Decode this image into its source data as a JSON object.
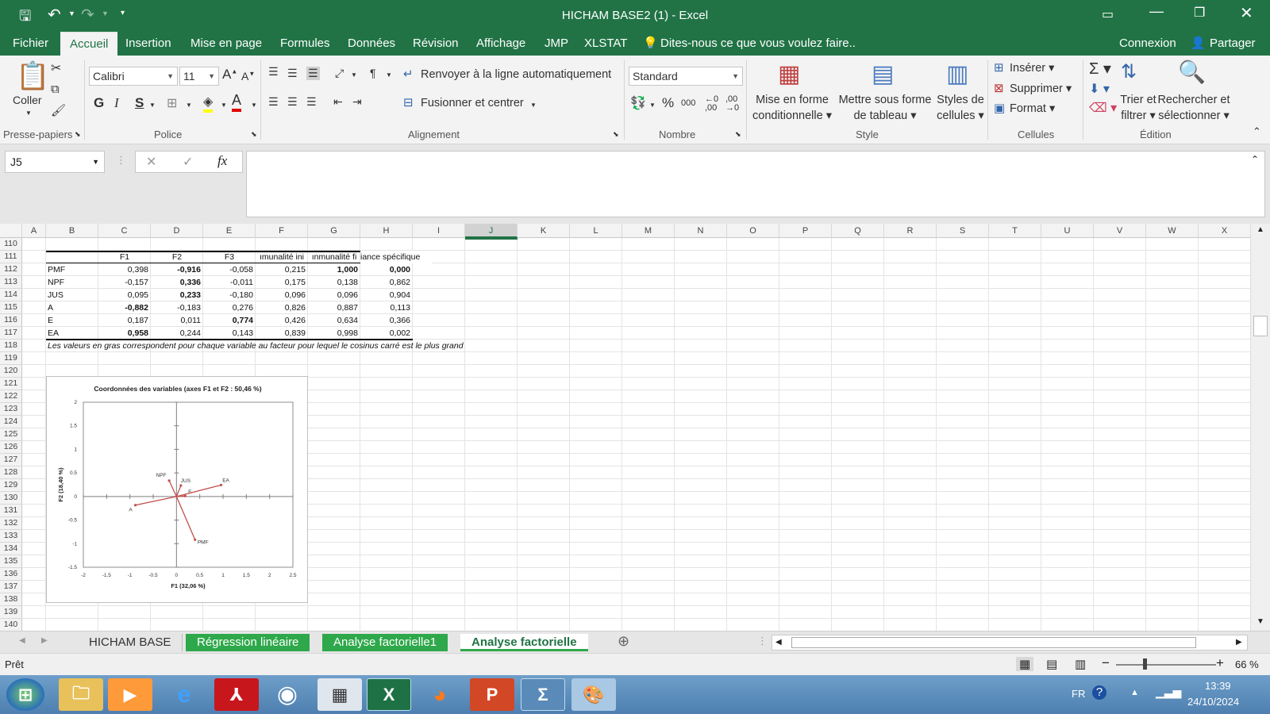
{
  "window": {
    "title": "HICHAM BASE2 (1) - Excel"
  },
  "tabs": [
    "Fichier",
    "Accueil",
    "Insertion",
    "Mise en page",
    "Formules",
    "Données",
    "Révision",
    "Affichage",
    "JMP",
    "XLSTAT"
  ],
  "tellme": "Dites-nous ce que vous voulez faire..",
  "account": {
    "signin": "Connexion",
    "share": "Partager"
  },
  "ribbon": {
    "clipboard": {
      "paste": "Coller",
      "label": "Presse-papiers"
    },
    "font": {
      "name": "Calibri",
      "size": "11",
      "label": "Police",
      "bold": "G",
      "italic": "I",
      "underline": "S"
    },
    "alignment": {
      "wrap": "Renvoyer à la ligne automatiquement",
      "merge": "Fusionner et centrer",
      "label": "Alignement"
    },
    "number": {
      "format": "Standard",
      "label": "Nombre",
      "percent": "%",
      "thousands": "000"
    },
    "style": {
      "cond": "Mise en forme conditionnelle",
      "table": "Mettre sous forme de tableau",
      "cellstyles": "Styles de cellules",
      "label": "Style"
    },
    "cells": {
      "insert": "Insérer",
      "delete": "Supprimer",
      "format": "Format",
      "label": "Cellules"
    },
    "editing": {
      "sort": "Trier et filtrer",
      "find": "Rechercher et sélectionner",
      "label": "Édition"
    }
  },
  "formula": {
    "namebox": "J5",
    "fx": "fx",
    "value": ""
  },
  "columns": [
    "A",
    "B",
    "C",
    "D",
    "E",
    "F",
    "G",
    "H",
    "I",
    "J",
    "K",
    "L",
    "M",
    "N",
    "O",
    "P",
    "Q",
    "R",
    "S",
    "T",
    "U",
    "V",
    "W",
    "X"
  ],
  "rows": [
    "110",
    "111",
    "112",
    "113",
    "114",
    "115",
    "116",
    "117",
    "118",
    "119",
    "120",
    "121",
    "122",
    "123",
    "124",
    "125",
    "126",
    "127",
    "128",
    "129",
    "130",
    "131",
    "132",
    "133",
    "134",
    "135",
    "136",
    "137",
    "138",
    "139",
    "140"
  ],
  "table": {
    "headers": [
      "F1",
      "F2",
      "F3",
      "ımunalité ini",
      "ınmunalité fi",
      "iance spécifique"
    ],
    "rows": [
      {
        "name": "PMF",
        "v": [
          "0,398",
          "-0,916",
          "-0,058",
          "0,215",
          "1,000",
          "0,000"
        ],
        "bold": [
          1,
          4,
          5
        ]
      },
      {
        "name": "NPF",
        "v": [
          "-0,157",
          "0,336",
          "-0,011",
          "0,175",
          "0,138",
          "0,862"
        ],
        "bold": [
          1
        ]
      },
      {
        "name": "JUS",
        "v": [
          "0,095",
          "0,233",
          "-0,180",
          "0,096",
          "0,096",
          "0,904"
        ],
        "bold": [
          1
        ]
      },
      {
        "name": "A",
        "v": [
          "-0,882",
          "-0,183",
          "0,276",
          "0,826",
          "0,887",
          "0,113"
        ],
        "bold": [
          0
        ]
      },
      {
        "name": "E",
        "v": [
          "0,187",
          "0,011",
          "0,774",
          "0,426",
          "0,634",
          "0,366"
        ],
        "bold": [
          2
        ]
      },
      {
        "name": "EA",
        "v": [
          "0,958",
          "0,244",
          "0,143",
          "0,839",
          "0,998",
          "0,002"
        ],
        "bold": [
          0
        ]
      }
    ],
    "note": "Les valeurs en gras correspondent pour chaque variable au facteur pour lequel le cosinus carré est le plus grand"
  },
  "chart_data": {
    "type": "scatter",
    "title": "Coordonnées des variables (axes F1 et F2 : 50,46 %)",
    "xlabel": "F1 (32,06 %)",
    "ylabel": "F2 (18,40 %)",
    "xlim": [
      -2,
      2.5
    ],
    "ylim": [
      -1.5,
      2
    ],
    "xticks": [
      "-2",
      "-1.5",
      "-1",
      "-0.5",
      "0",
      "0.5",
      "1",
      "1.5",
      "2",
      "2.5"
    ],
    "yticks": [
      "2",
      "1.5",
      "1",
      "0.5",
      "0",
      "-0.5",
      "-1",
      "-1.5"
    ],
    "color": "#c0504d",
    "points": [
      {
        "label": "PMF",
        "x": 0.398,
        "y": -0.916
      },
      {
        "label": "NPF",
        "x": -0.157,
        "y": 0.336
      },
      {
        "label": "JUS",
        "x": 0.095,
        "y": 0.233
      },
      {
        "label": "A",
        "x": -0.882,
        "y": -0.183
      },
      {
        "label": "E",
        "x": 0.187,
        "y": 0.011
      },
      {
        "label": "EA",
        "x": 0.958,
        "y": 0.244
      }
    ]
  },
  "sheets": [
    {
      "name": "HICHAM BASE",
      "state": "normal"
    },
    {
      "name": "Régression linéaire",
      "state": "green"
    },
    {
      "name": "Analyse factorielle1",
      "state": "green"
    },
    {
      "name": "Analyse factorielle",
      "state": "active"
    }
  ],
  "status": {
    "ready": "Prêt",
    "zoom": "66 %"
  },
  "tray": {
    "lang": "FR",
    "time": "13:39",
    "date": "24/10/2024"
  }
}
